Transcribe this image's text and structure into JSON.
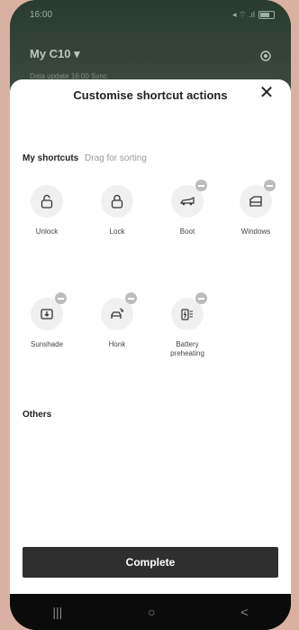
{
  "status_bar": {
    "time": "16:00",
    "icons": "◂ ⌔ .ıl"
  },
  "header": {
    "car_name": "My C10 ▾",
    "subtitle": "Data update 16:00 Sync"
  },
  "sheet": {
    "title": "Customise shortcut actions",
    "close_label": "✕",
    "my_shortcuts_label": "My shortcuts",
    "drag_hint": "Drag for sorting",
    "shortcuts": [
      {
        "label": "Unlock",
        "icon": "unlock-icon",
        "removable": false
      },
      {
        "label": "Lock",
        "icon": "lock-icon",
        "removable": false
      },
      {
        "label": "Boot",
        "icon": "car-boot-icon",
        "removable": true
      },
      {
        "label": "Windows",
        "icon": "window-icon",
        "removable": true
      },
      {
        "label": "Sunshade",
        "icon": "sunshade-icon",
        "removable": true
      },
      {
        "label": "Honk",
        "icon": "honk-icon",
        "removable": true
      },
      {
        "label": "Battery preheating",
        "icon": "battery-preheat-icon",
        "removable": true
      }
    ],
    "others_label": "Others",
    "complete_label": "Complete"
  },
  "nav": {
    "recents": "|||",
    "home": "○",
    "back": "<"
  }
}
